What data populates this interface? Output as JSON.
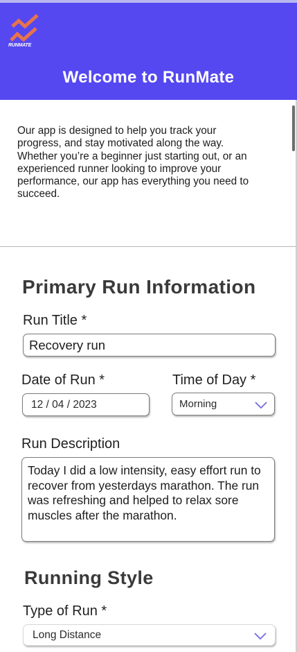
{
  "header": {
    "logo_text": "RUNMATE",
    "title": "Welcome to RunMate"
  },
  "intro": {
    "text": "Our  app is designed to help you track your progress, and stay motivated along the way. Whether you’re a beginner just starting out, or an experienced runner looking to improve your performance, our app has everything you need to succeed."
  },
  "primary": {
    "section_title": "Primary Run Information",
    "run_title": {
      "label": "Run Title *",
      "value": "Recovery run"
    },
    "date": {
      "label": "Date of Run *",
      "value": "12 / 04 / 2023"
    },
    "time_of_day": {
      "label": "Time of Day *",
      "value": "Morning"
    },
    "description": {
      "label": "Run Description",
      "value": "Today I did a low intensity, easy effort run to recover from yesterdays marathon. The run was refreshing and helped to relax sore muscles after the marathon."
    }
  },
  "style": {
    "section_title": "Running Style",
    "type_of_run": {
      "label": "Type of Run *",
      "value": "Long Distance"
    }
  },
  "colors": {
    "header_bg": "#5548f0",
    "logo_accent": "#e8734c",
    "chevron": "#7f76e6"
  },
  "icons": {
    "logo": "runmate-logo-icon",
    "dropdown": "chevron-down-icon"
  }
}
